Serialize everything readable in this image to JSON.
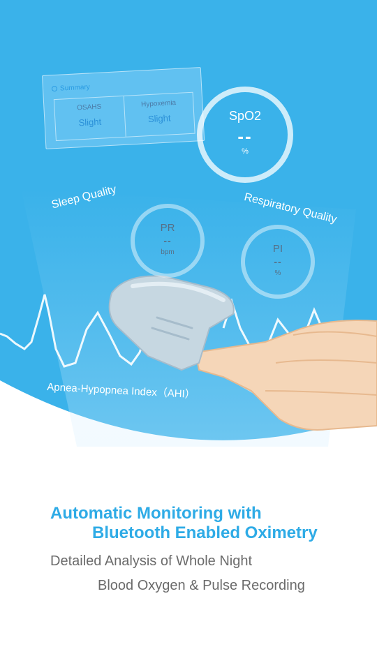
{
  "summary_card": {
    "title": "Summary",
    "columns": [
      {
        "header": "OSAHS",
        "value": "Slight"
      },
      {
        "header": "Hypoxemia",
        "value": "Slight"
      }
    ]
  },
  "gauges": {
    "spo2": {
      "label": "SpO2",
      "value": "--",
      "unit": "%"
    },
    "pr": {
      "label": "PR",
      "value": "--",
      "unit": "bpm"
    },
    "pi": {
      "label": "PI",
      "value": "--",
      "unit": "%"
    }
  },
  "labels": {
    "sleep_quality": "Sleep Quality",
    "respiratory_quality": "Respiratory Quality",
    "ahi": "Apnea-Hypopnea Index（AHI）"
  },
  "headline": {
    "line1": "Automatic Monitoring with",
    "line2": "Bluetooth Enabled Oximetry"
  },
  "subtitle": {
    "line1": "Detailed Analysis of Whole Night",
    "line2": "Blood Oxygen & Pulse Recording"
  },
  "colors": {
    "hero_blue": "#3ab2ea",
    "headline_blue": "#2eabe6",
    "subtitle_gray": "#6b6b6b"
  }
}
